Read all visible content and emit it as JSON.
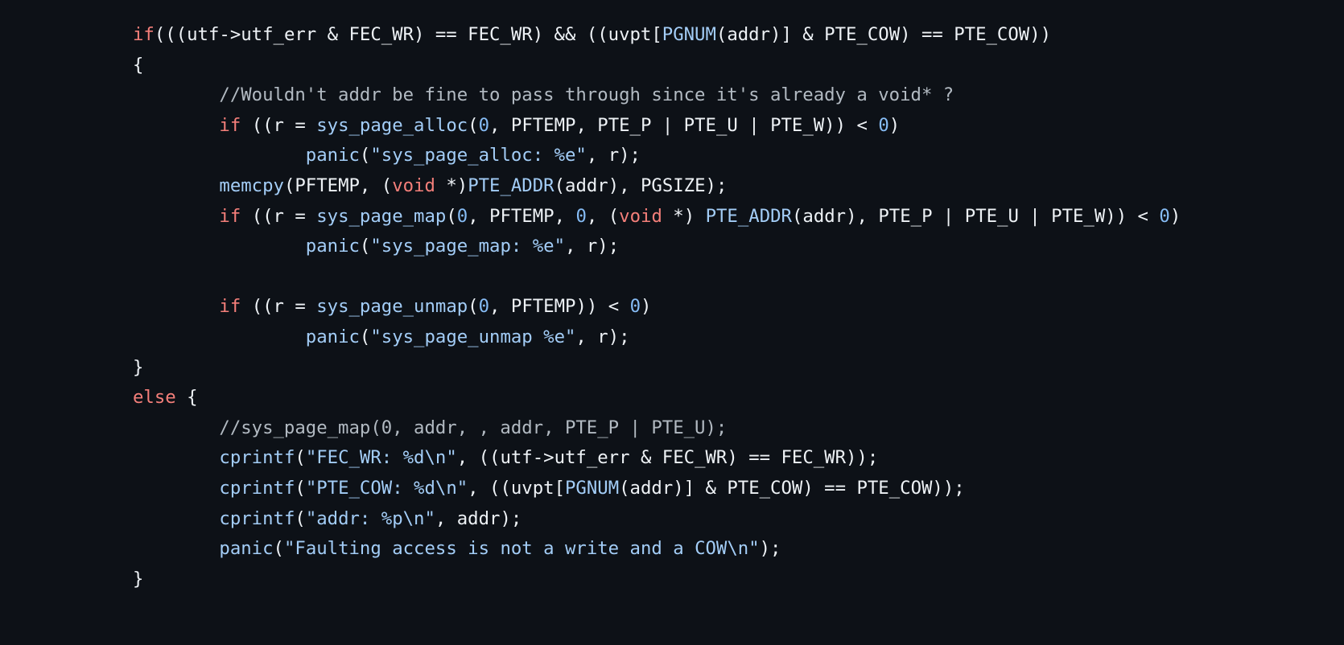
{
  "code_lines": [
    [
      [
        "kw",
        "if"
      ],
      [
        "pl",
        "(((utf->utf_err & FEC_WR) == FEC_WR) && ((uvpt["
      ],
      [
        "fn",
        "PGNUM"
      ],
      [
        "pl",
        "(addr)] & PTE_COW) == PTE_COW))"
      ]
    ],
    [
      [
        "pl",
        "{"
      ]
    ],
    [
      [
        "cm",
        "        //Wouldn't addr be fine to pass through since it's already a void* ?"
      ]
    ],
    [
      [
        "pl",
        "        "
      ],
      [
        "kw",
        "if"
      ],
      [
        "pl",
        " ((r = "
      ],
      [
        "fn",
        "sys_page_alloc"
      ],
      [
        "pl",
        "("
      ],
      [
        "num",
        "0"
      ],
      [
        "pl",
        ", PFTEMP, PTE_P | PTE_U | PTE_W)) < "
      ],
      [
        "num",
        "0"
      ],
      [
        "pl",
        ")"
      ]
    ],
    [
      [
        "pl",
        "                "
      ],
      [
        "fn",
        "panic"
      ],
      [
        "pl",
        "("
      ],
      [
        "str",
        "\"sys_page_alloc: %e\""
      ],
      [
        "pl",
        ", r);"
      ]
    ],
    [
      [
        "pl",
        "        "
      ],
      [
        "fn",
        "memcpy"
      ],
      [
        "pl",
        "(PFTEMP, ("
      ],
      [
        "kw",
        "void"
      ],
      [
        "pl",
        " *)"
      ],
      [
        "fn",
        "PTE_ADDR"
      ],
      [
        "pl",
        "(addr), PGSIZE);"
      ]
    ],
    [
      [
        "pl",
        "        "
      ],
      [
        "kw",
        "if"
      ],
      [
        "pl",
        " ((r = "
      ],
      [
        "fn",
        "sys_page_map"
      ],
      [
        "pl",
        "("
      ],
      [
        "num",
        "0"
      ],
      [
        "pl",
        ", PFTEMP, "
      ],
      [
        "num",
        "0"
      ],
      [
        "pl",
        ", ("
      ],
      [
        "kw",
        "void"
      ],
      [
        "pl",
        " *) "
      ],
      [
        "fn",
        "PTE_ADDR"
      ],
      [
        "pl",
        "(addr), PTE_P | PTE_U | PTE_W)) < "
      ],
      [
        "num",
        "0"
      ],
      [
        "pl",
        ")"
      ]
    ],
    [
      [
        "pl",
        "                "
      ],
      [
        "fn",
        "panic"
      ],
      [
        "pl",
        "("
      ],
      [
        "str",
        "\"sys_page_map: %e\""
      ],
      [
        "pl",
        ", r);"
      ]
    ],
    [
      [
        "pl",
        " "
      ]
    ],
    [
      [
        "pl",
        "        "
      ],
      [
        "kw",
        "if"
      ],
      [
        "pl",
        " ((r = "
      ],
      [
        "fn",
        "sys_page_unmap"
      ],
      [
        "pl",
        "("
      ],
      [
        "num",
        "0"
      ],
      [
        "pl",
        ", PFTEMP)) < "
      ],
      [
        "num",
        "0"
      ],
      [
        "pl",
        ")"
      ]
    ],
    [
      [
        "pl",
        "                "
      ],
      [
        "fn",
        "panic"
      ],
      [
        "pl",
        "("
      ],
      [
        "str",
        "\"sys_page_unmap %e\""
      ],
      [
        "pl",
        ", r);"
      ]
    ],
    [
      [
        "pl",
        "}"
      ]
    ],
    [
      [
        "kw",
        "else"
      ],
      [
        "pl",
        " {"
      ]
    ],
    [
      [
        "cm",
        "        //sys_page_map(0, addr, , addr, PTE_P | PTE_U);"
      ]
    ],
    [
      [
        "pl",
        "        "
      ],
      [
        "fn",
        "cprintf"
      ],
      [
        "pl",
        "("
      ],
      [
        "str",
        "\"FEC_WR: %d\\n\""
      ],
      [
        "pl",
        ", ((utf->utf_err & FEC_WR) == FEC_WR));"
      ]
    ],
    [
      [
        "pl",
        "        "
      ],
      [
        "fn",
        "cprintf"
      ],
      [
        "pl",
        "("
      ],
      [
        "str",
        "\"PTE_COW: %d\\n\""
      ],
      [
        "pl",
        ", ((uvpt["
      ],
      [
        "fn",
        "PGNUM"
      ],
      [
        "pl",
        "(addr)] & PTE_COW) == PTE_COW));"
      ]
    ],
    [
      [
        "pl",
        "        "
      ],
      [
        "fn",
        "cprintf"
      ],
      [
        "pl",
        "("
      ],
      [
        "str",
        "\"addr: %p\\n\""
      ],
      [
        "pl",
        ", addr);"
      ]
    ],
    [
      [
        "pl",
        "        "
      ],
      [
        "fn",
        "panic"
      ],
      [
        "pl",
        "("
      ],
      [
        "str",
        "\"Faulting access is not a write and a COW\\n\""
      ],
      [
        "pl",
        ");"
      ]
    ],
    [
      [
        "pl",
        "}"
      ]
    ]
  ]
}
